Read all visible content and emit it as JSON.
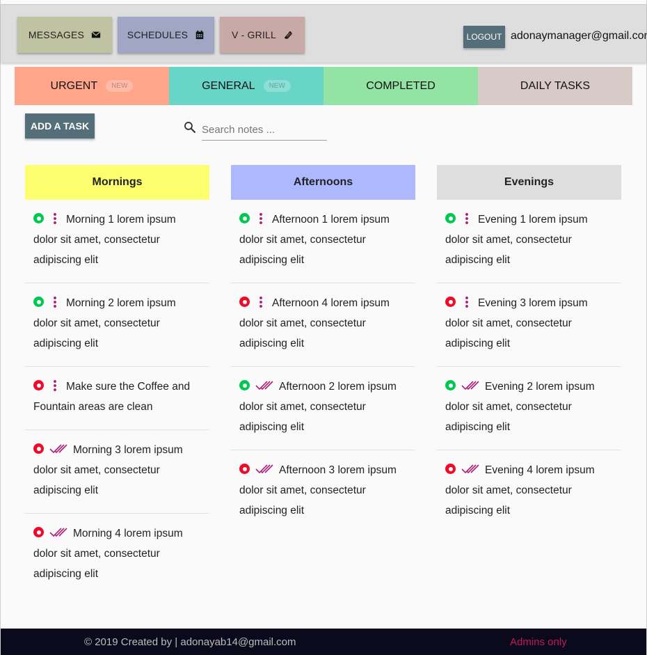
{
  "nav": {
    "buttons": [
      {
        "label": "MESSAGES",
        "icon": "envelope-icon",
        "color": "#bfc3a1"
      },
      {
        "label": "SCHEDULES",
        "icon": "calendar-icon",
        "color": "#a0a6c4"
      },
      {
        "label": "V - GRILL",
        "icon": "fork-knife-icon",
        "color": "#c7a9a6"
      }
    ],
    "logout_label": "LOGOUT",
    "user_email": "adonaymanager@gmail.com"
  },
  "tabs": [
    {
      "label": "URGENT",
      "badge": "NEW",
      "color": "#ffa58a"
    },
    {
      "label": "GENERAL",
      "badge": "NEW",
      "color": "#67d5c8"
    },
    {
      "label": "COMPLETED",
      "badge": "",
      "color": "#92e3a4"
    },
    {
      "label": "DAILY TASKS",
      "badge": "",
      "color": "#d8cac6"
    }
  ],
  "toolbar": {
    "add_task_label": "ADD A TASK",
    "search_placeholder": "Search notes ..."
  },
  "columns": [
    {
      "title": "Mornings",
      "color": "#fdff6f",
      "tasks": [
        {
          "text": "Morning 1 lorem ipsum dolor sit amet, consectetur adipiscing elit",
          "status": "green",
          "marker": "menu"
        },
        {
          "text": "Morning 2 lorem ipsum dolor sit amet, consectetur adipiscing elit",
          "status": "green",
          "marker": "menu"
        },
        {
          "text": "Make sure the Coffee and Fountain areas are clean",
          "status": "red",
          "marker": "menu"
        },
        {
          "text": "Morning 3 lorem ipsum dolor sit amet, consectetur adipiscing elit",
          "status": "red",
          "marker": "done"
        },
        {
          "text": "Morning 4 lorem ipsum dolor sit amet, consectetur adipiscing elit",
          "status": "red",
          "marker": "done"
        }
      ]
    },
    {
      "title": "Afternoons",
      "color": "#adb8ff",
      "tasks": [
        {
          "text": "Afternoon 1 lorem ipsum dolor sit amet, consectetur adipiscing elit",
          "status": "green",
          "marker": "menu"
        },
        {
          "text": "Afternoon 4 lorem ipsum dolor sit amet, consectetur adipiscing elit",
          "status": "red",
          "marker": "menu"
        },
        {
          "text": "Afternoon 2 lorem ipsum dolor sit amet, consectetur adipiscing elit",
          "status": "green",
          "marker": "done"
        },
        {
          "text": "Afternoon 3 lorem ipsum dolor sit amet, consectetur adipiscing elit",
          "status": "red",
          "marker": "done"
        }
      ]
    },
    {
      "title": "Evenings",
      "color": "#dedede",
      "tasks": [
        {
          "text": "Evening 1 lorem ipsum dolor sit amet, consectetur adipiscing elit",
          "status": "green",
          "marker": "menu"
        },
        {
          "text": "Evening 3 lorem ipsum dolor sit amet, consectetur adipiscing elit",
          "status": "red",
          "marker": "menu"
        },
        {
          "text": "Evening 2 lorem ipsum dolor sit amet, consectetur adipiscing elit",
          "status": "green",
          "marker": "done"
        },
        {
          "text": "Evening 4 lorem ipsum dolor sit amet, consectetur adipiscing elit",
          "status": "red",
          "marker": "done"
        }
      ]
    }
  ],
  "footer": {
    "copyright": "© 2019 Created by | adonayab14@gmail.com",
    "admins_label": "Admins only"
  }
}
